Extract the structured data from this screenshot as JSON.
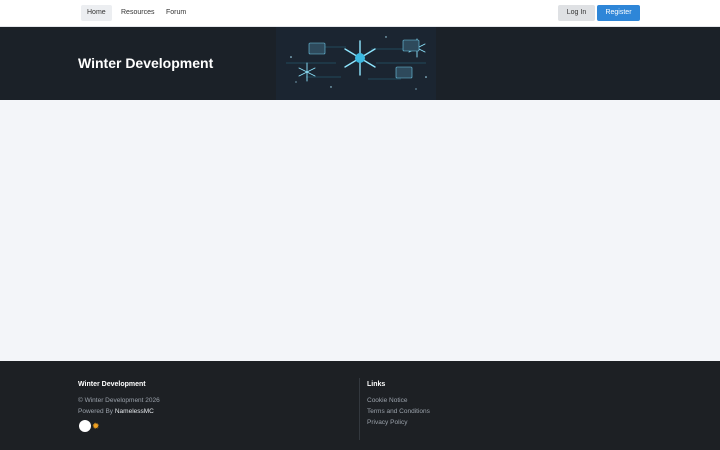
{
  "nav": {
    "items": [
      {
        "label": "Home"
      },
      {
        "label": "Resources"
      },
      {
        "label": "Forum"
      }
    ],
    "login_label": "Log In",
    "register_label": "Register"
  },
  "hero": {
    "title": "Winter Development",
    "banner_icons": [
      "snowflake-icon",
      "code-terminal-icon"
    ]
  },
  "footer": {
    "brand": "Winter Development",
    "copyright": "© Winter Development 2026",
    "powered_prefix": "Powered By",
    "powered_link": "NamelessMC",
    "links_heading": "Links",
    "links": [
      {
        "label": "Cookie Notice"
      },
      {
        "label": "Terms and Conditions"
      },
      {
        "label": "Privacy Policy"
      }
    ]
  },
  "colors": {
    "accent": "#2e86d8",
    "hero_bg": "#1b2128",
    "footer_bg": "#1d2024",
    "page_bg": "#f3f5f9"
  }
}
